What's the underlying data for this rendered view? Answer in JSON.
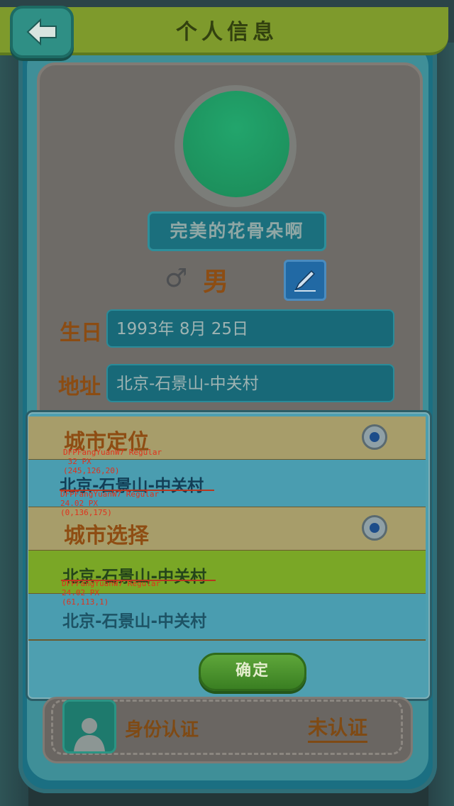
{
  "header": {
    "title": "个人信息"
  },
  "profile": {
    "nickname": "完美的花骨朵啊",
    "gender_symbol": "♂",
    "gender": "男",
    "birthday_label": "生日",
    "birthday_value": "1993年 8月 25日",
    "address_label": "地址",
    "address_value": "北京-石景山-中关村"
  },
  "city_dialog": {
    "locate_title": "城市定位",
    "locate_city": "北京-石景山-中关村",
    "select_title": "城市选择",
    "options": [
      "北京-石景山-中关村",
      "北京-石景山-中关村"
    ],
    "confirm_label": "确定"
  },
  "annotations": [
    "DFPFangYuanW7 Regular\n 32 PX\n(245,126,20)",
    "DFPFangYuanW7 Regular\n24.02 PX\n(0,136,175)",
    "DFPFangYuanW7 Regular\n24.02 PX\n(61,113,1)"
  ],
  "identity": {
    "label": "身份认证",
    "status": "未认证"
  },
  "colors": {
    "header": "#7e9a2c",
    "accent_text": "#8b4c13",
    "selected_row": "#7aa726",
    "annotation": "#e0321c"
  },
  "icons": {
    "back": "arrow-left-icon",
    "edit": "pen-icon",
    "radio": "radio-icon",
    "user": "user-silhouette-icon"
  }
}
